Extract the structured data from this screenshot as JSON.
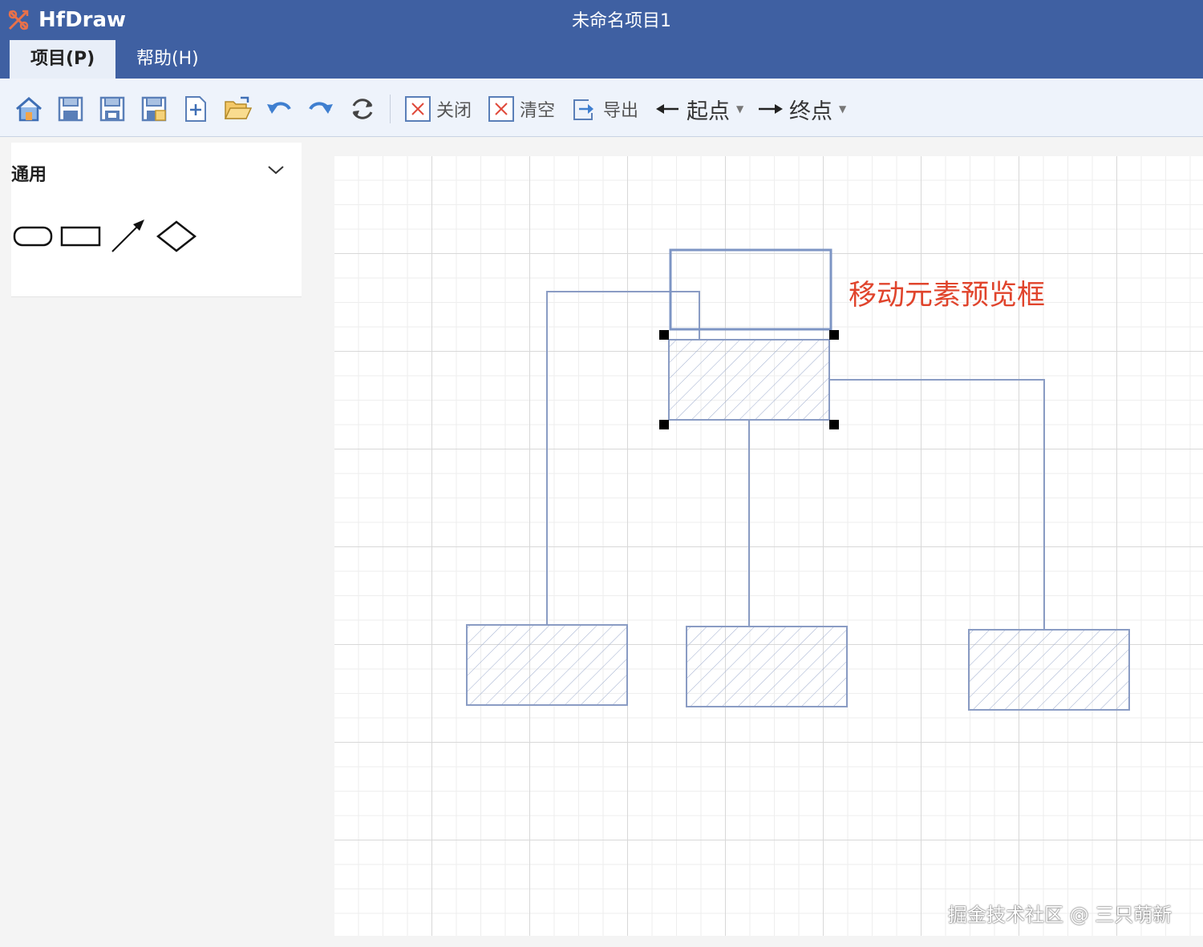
{
  "app": {
    "name": "HfDraw",
    "window_title": "未命名项目1"
  },
  "menu": {
    "tabs": [
      {
        "label": "项目(P)",
        "active": true
      },
      {
        "label": "帮助(H)",
        "active": false
      }
    ]
  },
  "toolbar": {
    "icons": [
      "home-icon",
      "save-icon",
      "save-as-icon",
      "save-local-icon",
      "new-file-icon",
      "open-folder-icon",
      "undo-icon",
      "redo-icon",
      "refresh-icon"
    ],
    "close_label": "关闭",
    "clear_label": "清空",
    "export_label": "导出",
    "start_label": "起点",
    "end_label": "终点"
  },
  "sidebar": {
    "section_title": "通用",
    "shapes": [
      "rounded-rect-icon",
      "rect-icon",
      "arrow-icon",
      "diamond-icon"
    ]
  },
  "canvas": {
    "annotation": "移动元素预览框",
    "hatch_color": "#8a9cc4",
    "selection_handle_color": "#000000"
  },
  "watermark": "掘金技术社区 @ 三只萌新",
  "colors": {
    "header": "#3f60a2",
    "toolbar": "#eef3fb",
    "annotation": "#e0442c",
    "node_stroke": "#8a9cc4"
  }
}
